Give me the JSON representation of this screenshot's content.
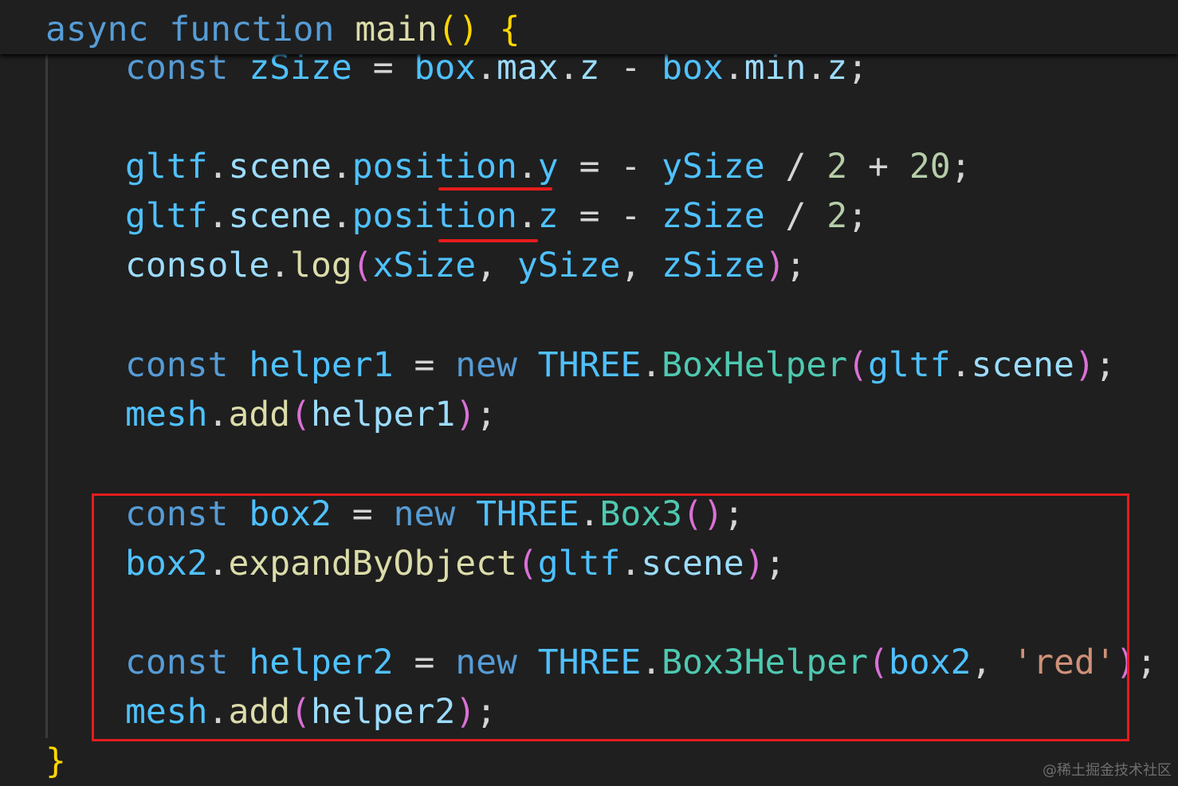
{
  "sticky": {
    "async_kw": "async",
    "function_kw": "function",
    "fn_name": "main",
    "parens": "()",
    "brace_open": "{"
  },
  "code": {
    "line_zsize": {
      "const": "const",
      "name": "zSize",
      "eq": "=",
      "box1": "box",
      "dot1": ".",
      "max": "max",
      "dot2": ".",
      "z1": "z",
      "minus": "-",
      "box2": "box",
      "dot3": ".",
      "min": "min",
      "dot4": ".",
      "z2": "z",
      "semi": ";"
    },
    "line_pos_y": {
      "gltf": "gltf",
      "dot1": ".",
      "scene": "scene",
      "dot2": ".",
      "position": "position",
      "dot3": ".",
      "axis": "y",
      "eq": "=",
      "minus": "-",
      "ysize": "ySize",
      "div": "/",
      "two": "2",
      "plus": "+",
      "twenty": "20",
      "semi": ";"
    },
    "line_pos_z": {
      "gltf": "gltf",
      "dot1": ".",
      "scene": "scene",
      "dot2": ".",
      "position": "position",
      "dot3": ".",
      "axis": "z",
      "eq": "=",
      "minus": "-",
      "zsize": "zSize",
      "div": "/",
      "two": "2",
      "semi": ";"
    },
    "line_console": {
      "console": "console",
      "dot": ".",
      "log": "log",
      "po": "(",
      "x": "xSize",
      "c1": ",",
      "y": "ySize",
      "c2": ",",
      "z": "zSize",
      "pc": ")",
      "semi": ";"
    },
    "line_helper1": {
      "const": "const",
      "name": "helper1",
      "eq": "=",
      "new": "new",
      "three": "THREE",
      "dot": ".",
      "cls": "BoxHelper",
      "po": "(",
      "gltf": "gltf",
      "dot2": ".",
      "scene": "scene",
      "pc": ")",
      "semi": ";"
    },
    "line_add1": {
      "mesh": "mesh",
      "dot": ".",
      "add": "add",
      "po": "(",
      "arg": "helper1",
      "pc": ")",
      "semi": ";"
    },
    "line_box2": {
      "const": "const",
      "name": "box2",
      "eq": "=",
      "new": "new",
      "three": "THREE",
      "dot": ".",
      "cls": "Box3",
      "po": "(",
      "pc": ")",
      "semi": ";"
    },
    "line_expand": {
      "box2": "box2",
      "dot": ".",
      "fn": "expandByObject",
      "po": "(",
      "gltf": "gltf",
      "dot2": ".",
      "scene": "scene",
      "pc": ")",
      "semi": ";"
    },
    "line_helper2": {
      "const": "const",
      "name": "helper2",
      "eq": "=",
      "new": "new",
      "three": "THREE",
      "dot": ".",
      "cls": "Box3Helper",
      "po": "(",
      "arg": "box2",
      "comma": ",",
      "str": "'red'",
      "pc": ")",
      "semi": ";"
    },
    "line_add2": {
      "mesh": "mesh",
      "dot": ".",
      "add": "add",
      "po": "(",
      "arg": "helper2",
      "pc": ")",
      "semi": ";"
    },
    "closing_brace": "}"
  },
  "watermark": "@稀土掘金技术社区",
  "colors": {
    "background": "#1f1f1f",
    "keyword": "#569cd6",
    "variable": "#4fc1ff",
    "property": "#9cdcfe",
    "function": "#dcdcaa",
    "class": "#4ec9b0",
    "number": "#b5cea8",
    "string": "#ce9178",
    "bracket_level1": "#ffd700",
    "bracket_level2": "#da70d6",
    "annotation_red": "#e61c1c"
  }
}
